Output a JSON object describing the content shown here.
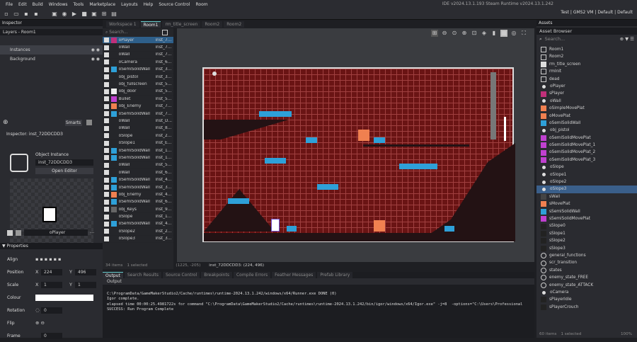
{
  "menu": [
    "File",
    "Edit",
    "Build",
    "Windows",
    "Tools",
    "Marketplace",
    "Layouts",
    "Help",
    "Source Control",
    "Room"
  ],
  "title": "IDE v2024.13.1.193 Steam  Runtime v2024.13.1.242",
  "target": "Test | GMS2 VM | Default | Default",
  "inspector": {
    "title": "Inspector",
    "layers_title": "Layers - Room1",
    "layers": [
      "Instances",
      "Background"
    ],
    "inspector_title": "Inspector: inst_72DDCDD3",
    "object_instance": "Object Instance",
    "instance_name": "inst_72DDCDD3",
    "open_editor": "Open Editor",
    "object_name": "oPlayer",
    "properties": "Properties",
    "align": "Align",
    "position": "Position",
    "x_label": "X",
    "y_label": "Y",
    "x": "224",
    "y": "496",
    "scale": "Scale",
    "sx": "1",
    "sy": "1",
    "colour": "Colour",
    "rotation": "Rotation",
    "rot": "0",
    "flip": "Flip",
    "frame": "Frame",
    "frame_val": "0",
    "smart": "Smarts",
    "count": "0/0"
  },
  "doc_tabs": [
    "Workspace 1",
    "Room1",
    "rm_title_screen",
    "Room2",
    "Room2"
  ],
  "instances": [
    [
      "oPlayer",
      "inst_7...",
      "#c0307a"
    ],
    [
      "oWall",
      "inst_7...",
      ""
    ],
    [
      "oWall",
      "inst_7...",
      ""
    ],
    [
      "oCamera",
      "inst_6...",
      ""
    ],
    [
      "oSemiSolidWall",
      "inst_3...",
      "#2ea0d8"
    ],
    [
      "obj_pistol",
      "inst_3...",
      ""
    ],
    [
      "obj_fullscreen",
      "inst_5...",
      ""
    ],
    [
      "obj_door",
      "inst_5...",
      "#eeeeee"
    ],
    [
      "Bullet",
      "inst_5...",
      "#c040d0"
    ],
    [
      "obj_Enemy",
      "inst_7...",
      "#f08050"
    ],
    [
      "oSemiSolidWall",
      "inst_7...",
      "#2ea0d8"
    ],
    [
      "oWall",
      "inst_D...",
      ""
    ],
    [
      "oWall",
      "inst_8...",
      ""
    ],
    [
      "oSlope",
      "inst_2...",
      ""
    ],
    [
      "oSlope1",
      "inst_E...",
      ""
    ],
    [
      "oSemiSolidWall",
      "inst_1...",
      "#2ea0d8"
    ],
    [
      "oSemiSolidWall",
      "inst_1...",
      "#2ea0d8"
    ],
    [
      "oWall",
      "inst_5...",
      ""
    ],
    [
      "oWall",
      "inst_6...",
      ""
    ],
    [
      "oSemiSolidWall",
      "inst_4...",
      "#2ea0d8"
    ],
    [
      "oSemiSolidWall",
      "inst_3...",
      "#2ea0d8"
    ],
    [
      "obj_Enemy",
      "inst_4...",
      "#f08050"
    ],
    [
      "oSemiSolidWall",
      "inst_6...",
      "#2ea0d8"
    ],
    [
      "obj_Keys",
      "inst_9...",
      "#666666"
    ],
    [
      "oSlope",
      "inst_1...",
      ""
    ],
    [
      "oSemiSolidWall",
      "inst_4...",
      "#2ea0d8"
    ],
    [
      "oSlope2",
      "inst_2...",
      ""
    ],
    [
      "oSlope3",
      "inst_3...",
      ""
    ]
  ],
  "status": {
    "items": "34 items",
    "selected": "1 selected",
    "coords": "(1225, -205)",
    "sel_info": "inst_72DDCDD3: (224, 496)"
  },
  "output": {
    "tabs": [
      "Output",
      "Search Results",
      "Source Control",
      "Breakpoints",
      "Compile Errors",
      "Feather Messages",
      "Prefab Library"
    ],
    "title": "Output",
    "lines": [
      "",
      "C:\\ProgramData/GameMakerStudio2/Cache/runtimes\\runtime-2024.13.1.242/windows/x64/Runner.exe DONE (0)",
      "Igor complete.",
      "elapsed time 00:00:25.4981722s for command \"C:\\ProgramData\\GameMakerStudio2/Cache/runtimes\\runtime-2024.13.1.242/bin/igor/windows/x64/Igor.exe\" -j=8  -options=\"C:\\Users\\Professional",
      "SUCCESS: Run Program Complete"
    ]
  },
  "assets": {
    "title": "Assets",
    "browser": "Asset Browser",
    "search": "Search...",
    "count": "60 items",
    "selected": "1 selected",
    "zoom": "100%",
    "items": [
      [
        "Room1",
        "room"
      ],
      [
        "Room2",
        "room"
      ],
      [
        "rm_title_screen",
        "folder"
      ],
      [
        "rmInit",
        "room"
      ],
      [
        "dead",
        "room"
      ],
      [
        "oPlayer",
        "obj"
      ],
      [
        "sPlayer",
        "#c0307a"
      ],
      [
        "oWall",
        "obj"
      ],
      [
        "oSimpleMovePlat",
        "#f08050"
      ],
      [
        "oMovePlat",
        "#f08050"
      ],
      [
        "oSemiSolidWall",
        "#2ea0d8"
      ],
      [
        "obj_pistol",
        "obj"
      ],
      [
        "oSemiSolidMovePlat",
        "#c040d0"
      ],
      [
        "oSemiSolidMovePlat_1",
        "#c040d0"
      ],
      [
        "oSemiSolidMovePlat_2",
        "#c040d0"
      ],
      [
        "oSemiSolidMovePlat_3",
        "#c040d0"
      ],
      [
        "oSlope",
        "obj"
      ],
      [
        "oSlope1",
        "obj"
      ],
      [
        "oSlope2",
        "obj"
      ],
      [
        "oSlope3",
        "sel"
      ],
      [
        "sWall",
        "#444444"
      ],
      [
        "sMovePlat",
        "#f08050"
      ],
      [
        "sSemiSolidWall",
        "#2ea0d8"
      ],
      [
        "sSemiSolidMovePlat",
        "#c040d0"
      ],
      [
        "sSlope0",
        "#222222"
      ],
      [
        "sSlope1",
        "#222222"
      ],
      [
        "sSlope2",
        "#222222"
      ],
      [
        "sSlope3",
        "#222222"
      ],
      [
        "general_functions",
        "script"
      ],
      [
        "scr_transition",
        "script"
      ],
      [
        "states",
        "script"
      ],
      [
        "enemy_state_FREE",
        "script"
      ],
      [
        "enemy_state_ATTACK",
        "script"
      ],
      [
        "oCamera",
        "obj"
      ],
      [
        "sPlayerIdle",
        "#222222"
      ],
      [
        "sPlayerCrouch",
        "#222222"
      ]
    ]
  },
  "room_bg": "#6a1414",
  "colors": {
    "accent": "#5fd0d0",
    "semisolid": "#2ea0d8",
    "moveplat": "#f08050"
  }
}
